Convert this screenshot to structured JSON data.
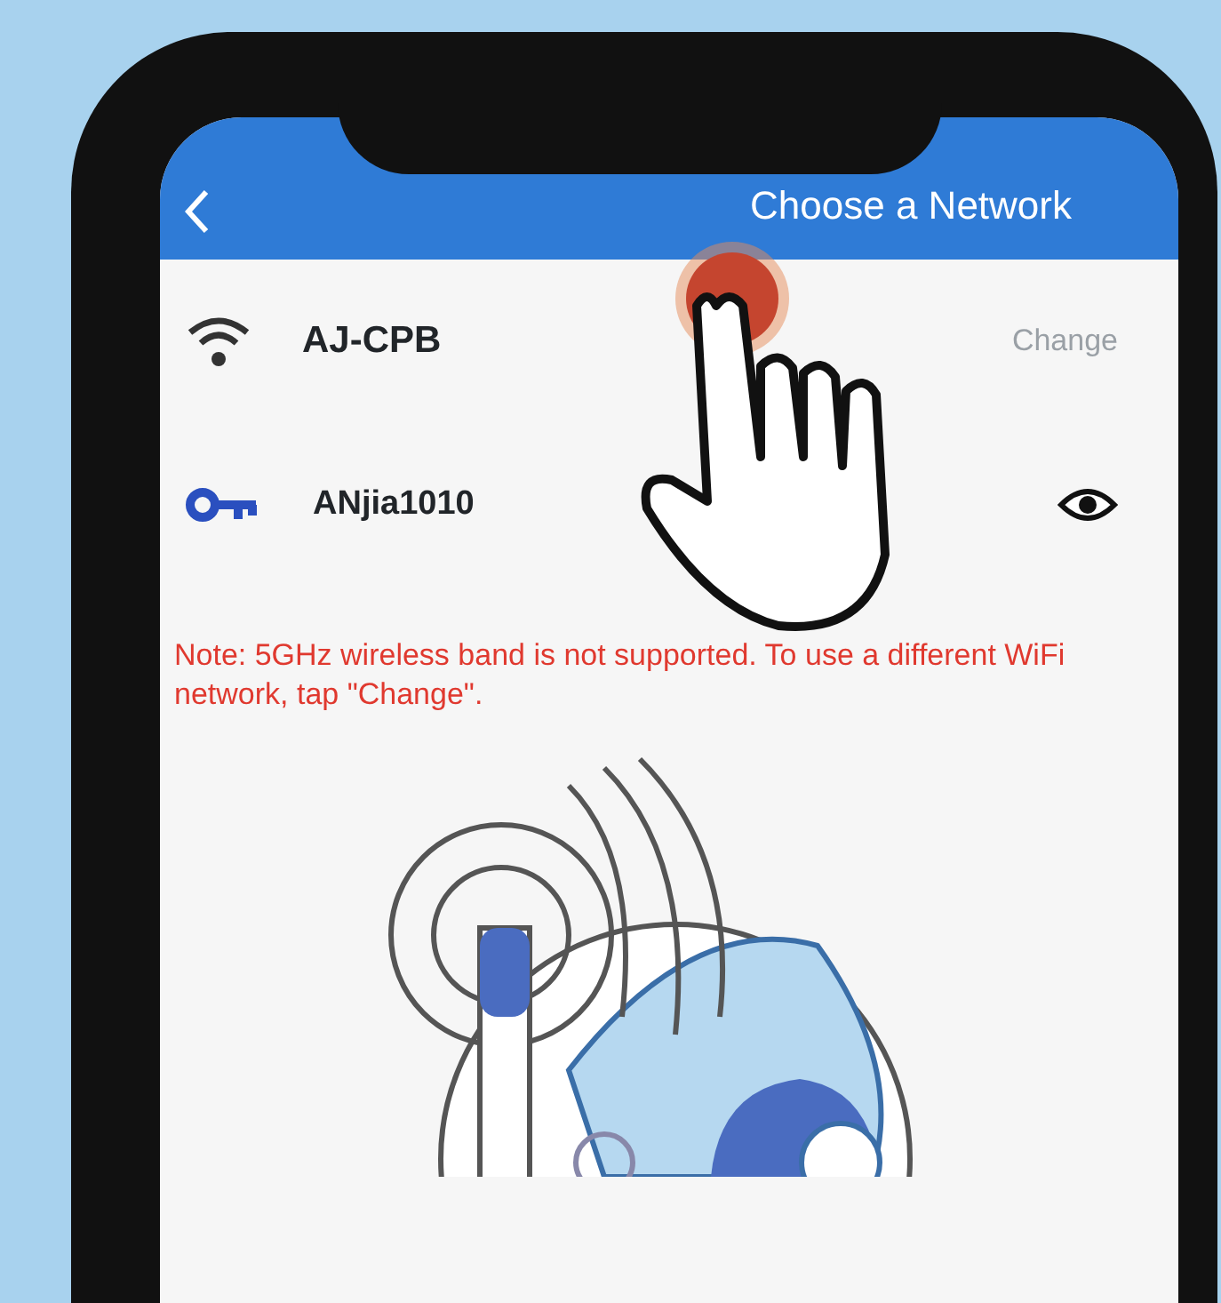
{
  "header": {
    "title": "Choose a Network"
  },
  "network": {
    "name": "AJ-CPB",
    "action": "Change"
  },
  "password": {
    "value": "ANjia1010",
    "visible": true
  },
  "note": "Note: 5GHz wireless band is not supported. To use a different WiFi network, tap \"Change\"."
}
